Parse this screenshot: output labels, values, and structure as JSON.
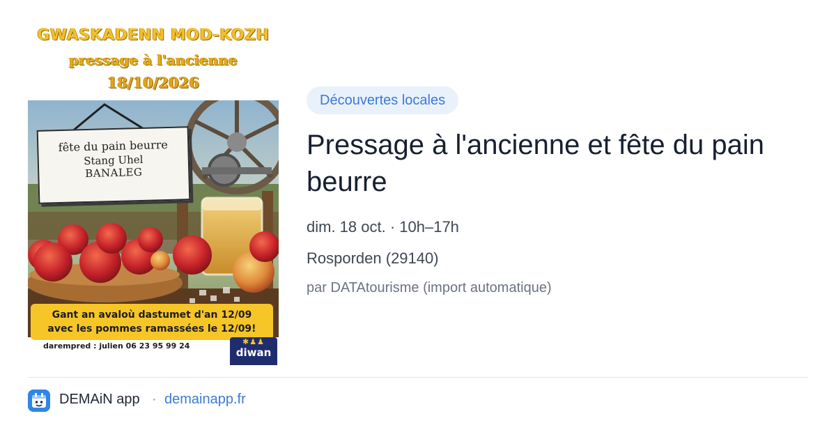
{
  "poster": {
    "title_line1": "GWASKADENN MOD-KOZH",
    "title_line2": "pressage à l'ancienne",
    "title_line3": "18/10/2026",
    "sign_line1": "fête du pain beurre",
    "sign_line2": "Stang Uhel",
    "sign_line3": "BANALEG",
    "banner_line1": "Gant an avaloù dastumet d'an 12/09",
    "banner_line2": "avec les pommes ramassées le 12/09!",
    "contact": "darempred : julien 06 23 95 99 24",
    "logo_text": "diwan"
  },
  "event": {
    "category": "Découvertes locales",
    "title": "Pressage à l'ancienne et fête du pain beurre",
    "datetime": "dim. 18 oct. · 10h–17h",
    "location": "Rosporden (29140)",
    "source": "par DATAtourisme (import automatique)"
  },
  "footer": {
    "app_name": "DEMAiN app",
    "separator": "·",
    "link": "demainapp.fr"
  },
  "colors": {
    "accent": "#3b7ad6",
    "tag_bg": "#e9f1fb",
    "title": "#172031",
    "poster_yellow": "#f6c528"
  }
}
